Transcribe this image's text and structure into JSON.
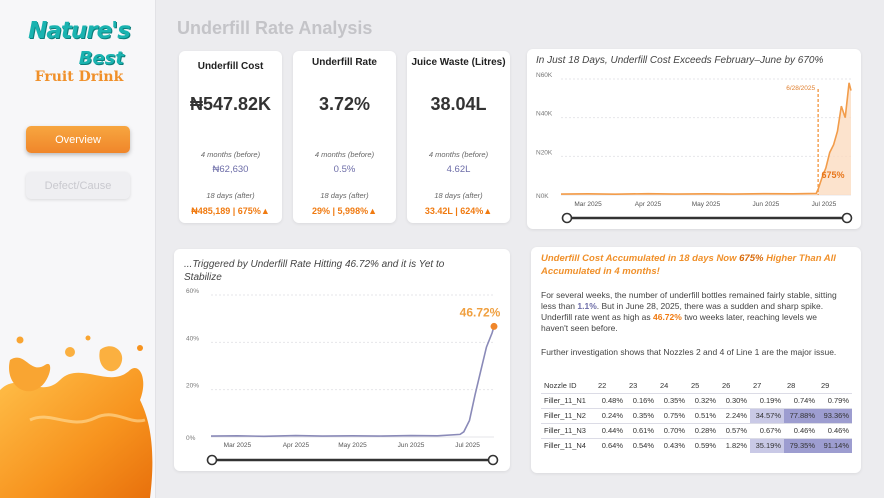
{
  "brand": {
    "name": "Nature's",
    "name2": "Best",
    "tagline": "Fruit Drink"
  },
  "nav": [
    {
      "label": "Overview",
      "active": true
    },
    {
      "label": "Defect/Cause",
      "active": false
    }
  ],
  "page_title": "Underfill Rate Analysis",
  "kpis": [
    {
      "label": "Underfill Cost",
      "value": "₦547.82K",
      "before_label": "4 months (before)",
      "before_value": "₦62,630",
      "after_label": "18 days (after)",
      "after_value": "₦485,189 | 675%▲"
    },
    {
      "label": "Underfill Rate",
      "value": "3.72%",
      "before_label": "4 months (before)",
      "before_value": "0.5%",
      "after_label": "18 days (after)",
      "after_value": "29% | 5,998%▲"
    },
    {
      "label": "Juice Waste (Litres)",
      "value": "38.04L",
      "before_label": "4 months (before)",
      "before_value": "4.62L",
      "after_label": "18 days (after)",
      "after_value": "33.42L | 624%▲"
    }
  ],
  "cost_chart": {
    "title": "In Just 18 Days, Underfill Cost Exceeds February–June by 670%",
    "marker_label": "6/28/2025",
    "callout": "675%"
  },
  "rate_chart": {
    "title": "...Triggered by Underfill Rate Hitting 46.72% and it is Yet to Stabilize",
    "callout": "46.72%"
  },
  "chart_data": [
    {
      "type": "area",
      "title": "In Just 18 Days, Underfill Cost Exceeds February–June by 670%",
      "x_tick_labels": [
        "Mar 2025",
        "Apr 2025",
        "May 2025",
        "Jun 2025",
        "Jul 2025"
      ],
      "y_tick_labels": [
        "N0K",
        "N20K",
        "N40K",
        "N60K"
      ],
      "ylim": [
        0,
        60000
      ],
      "grid": true,
      "annotations": [
        "6/28/2025",
        "675%"
      ],
      "series": [
        {
          "x": [
            "2025-02-15",
            "2025-03-01",
            "2025-03-15",
            "2025-04-01",
            "2025-04-15",
            "2025-05-01",
            "2025-05-15",
            "2025-06-01",
            "2025-06-15",
            "2025-06-27",
            "2025-06-28",
            "2025-06-30",
            "2025-07-02",
            "2025-07-04",
            "2025-07-06",
            "2025-07-08",
            "2025-07-10",
            "2025-07-12",
            "2025-07-14",
            "2025-07-15"
          ],
          "values": [
            500,
            600,
            400,
            700,
            500,
            600,
            500,
            700,
            600,
            800,
            3000,
            9000,
            14000,
            22000,
            26000,
            33000,
            46000,
            40000,
            58000,
            54000
          ]
        }
      ]
    },
    {
      "type": "line",
      "title": "...Triggered by Underfill Rate Hitting 46.72% and it is Yet to Stabilize",
      "x_tick_labels": [
        "Mar 2025",
        "Apr 2025",
        "May 2025",
        "Jun 2025",
        "Jul 2025"
      ],
      "y_tick_labels": [
        "0%",
        "20%",
        "40%",
        "60%"
      ],
      "ylim": [
        0,
        60
      ],
      "grid": true,
      "annotations": [
        "46.72%"
      ],
      "series": [
        {
          "x": [
            "2025-02-15",
            "2025-03-01",
            "2025-03-15",
            "2025-04-01",
            "2025-04-15",
            "2025-05-01",
            "2025-05-15",
            "2025-06-01",
            "2025-06-15",
            "2025-06-27",
            "2025-06-29",
            "2025-07-02",
            "2025-07-05",
            "2025-07-08",
            "2025-07-11",
            "2025-07-14",
            "2025-07-15"
          ],
          "values": [
            0.4,
            0.5,
            0.3,
            0.6,
            0.4,
            0.5,
            0.4,
            0.6,
            0.5,
            1.1,
            2.2,
            7,
            18,
            28,
            38,
            44,
            46.72
          ]
        }
      ]
    }
  ],
  "insight": {
    "head_a": "Underfill Cost Accumulated in 18 days Now ",
    "head_pct": "675%",
    "head_b": " Higher Than All Accumulated in 4 months!",
    "p1_a": "For several weeks, the number of underfill bottles remained fairly stable, sitting less than ",
    "p1_v1": "1.1%",
    "p1_b": ". But in June 28, 2025, there was a sudden and sharp spike. Underfill rate went as high as ",
    "p1_v2": "46.72%",
    "p1_c": " two weeks later, reaching levels we haven't seen before.",
    "p2": "Further investigation shows that Nozzles 2 and 4 of Line 1 are the major issue."
  },
  "nozzle_table": {
    "headers": [
      "Nozzle ID",
      "22",
      "23",
      "24",
      "25",
      "26",
      "27",
      "28",
      "29"
    ],
    "rows": [
      [
        "Filler_11_N1",
        "0.48%",
        "0.16%",
        "0.35%",
        "0.32%",
        "0.30%",
        "0.19%",
        "0.74%",
        "0.79%"
      ],
      [
        "Filler_11_N2",
        "0.24%",
        "0.35%",
        "0.75%",
        "0.51%",
        "2.24%",
        "34.57%",
        "77.88%",
        "93.36%"
      ],
      [
        "Filler_11_N3",
        "0.44%",
        "0.61%",
        "0.70%",
        "0.28%",
        "0.57%",
        "0.67%",
        "0.46%",
        "0.46%"
      ],
      [
        "Filler_11_N4",
        "0.64%",
        "0.54%",
        "0.43%",
        "0.59%",
        "1.82%",
        "35.19%",
        "79.35%",
        "91.14%"
      ]
    ]
  }
}
